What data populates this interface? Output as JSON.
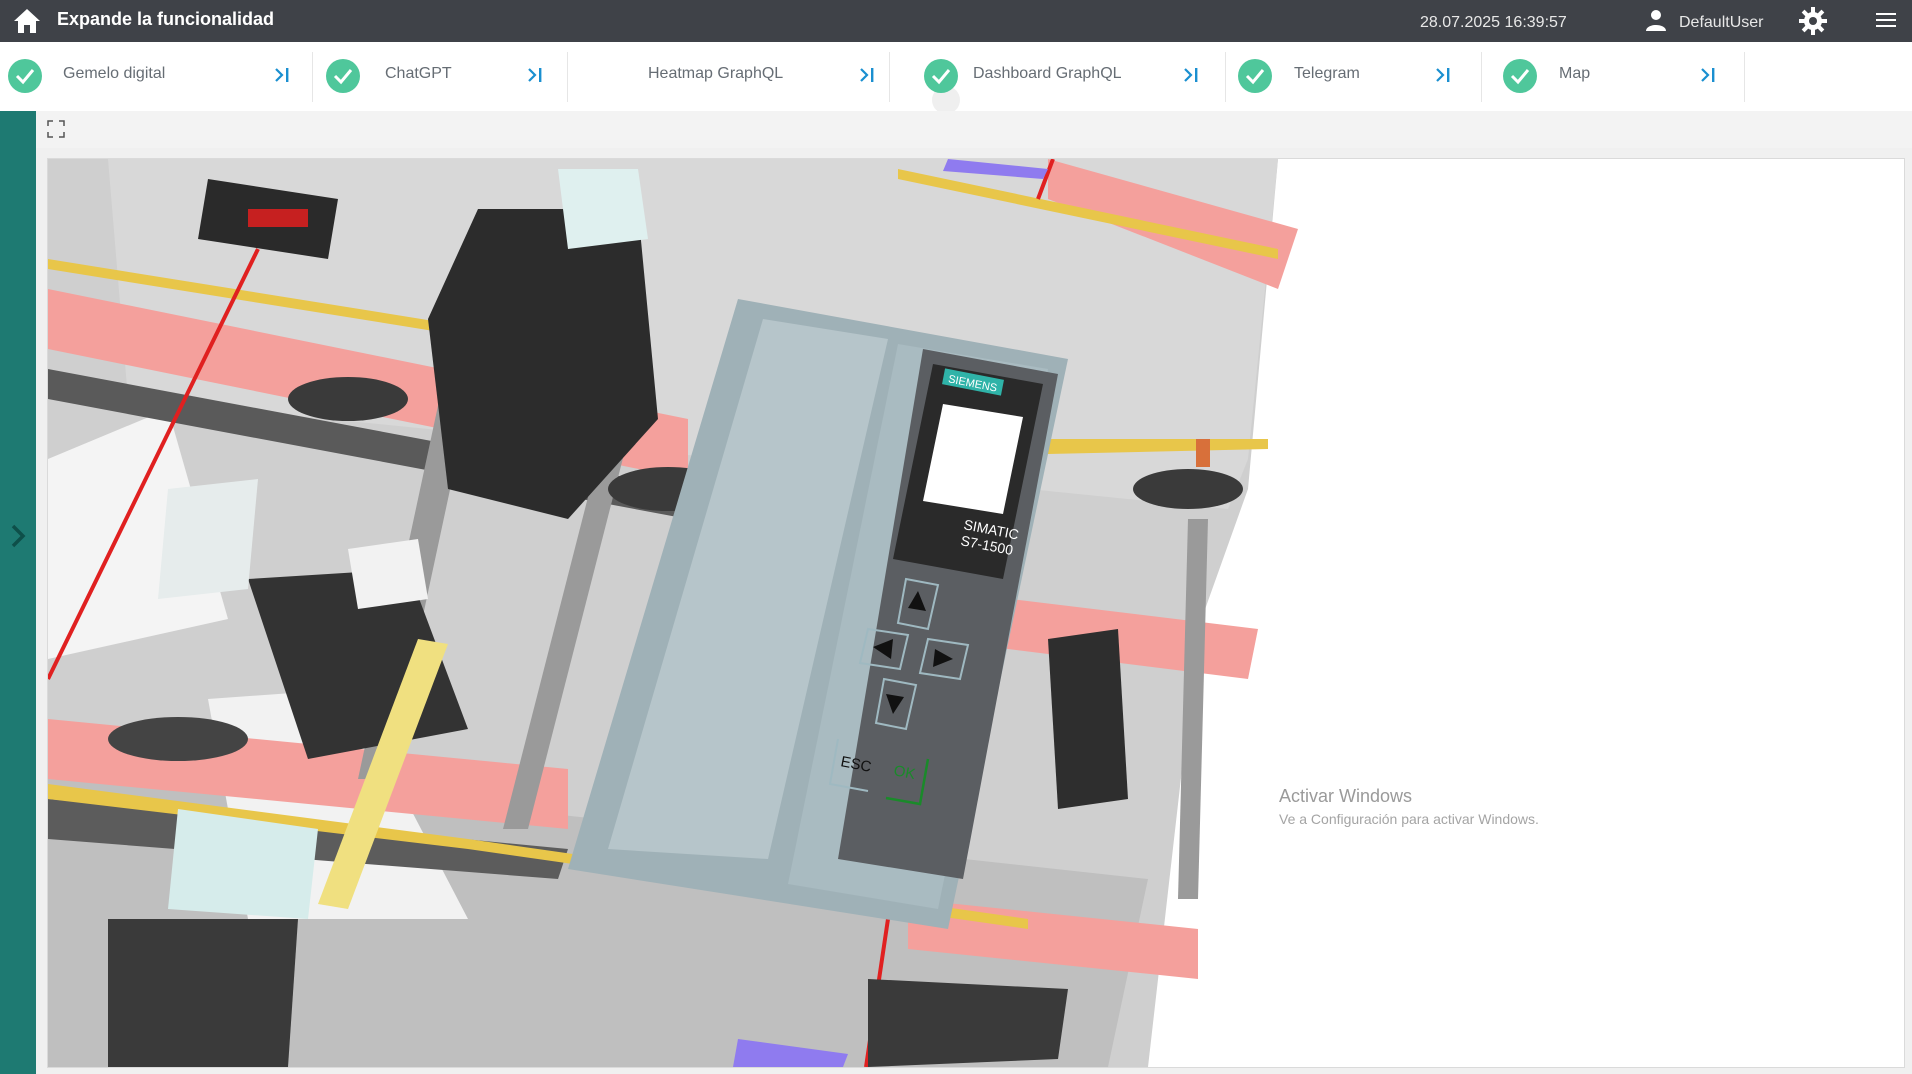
{
  "header": {
    "title": "Expande la funcionalidad",
    "datetime": "28.07.2025 16:39:57",
    "user": "DefaultUser",
    "icons": {
      "home": "home-icon",
      "user": "user-icon",
      "settings": "gear-icon",
      "menu": "hamburger-icon"
    },
    "bg_color": "#3f4248"
  },
  "tabs": [
    {
      "label": "Gemelo digital",
      "status": "ok"
    },
    {
      "label": "ChatGPT",
      "status": "ok"
    },
    {
      "label": "Heatmap GraphQL",
      "status": "none"
    },
    {
      "label": "Dashboard GraphQL",
      "status": "ok"
    },
    {
      "label": "Telegram",
      "status": "ok"
    },
    {
      "label": "Map",
      "status": "ok"
    }
  ],
  "accent_colors": {
    "check": "#4fc79b",
    "collapse_icon": "#1a8fd0",
    "rail": "#1e7a72"
  },
  "viewer": {
    "scene_description_icon": "3d-model-viewer",
    "plc": {
      "brand": "SIEMENS",
      "model_line1": "SIMATIC",
      "model_line2": "S7-1500",
      "esc": "ESC",
      "ok": "OK"
    }
  },
  "watermark": {
    "title": "Activar Windows",
    "subtitle": "Ve a Configuración para activar Windows."
  }
}
